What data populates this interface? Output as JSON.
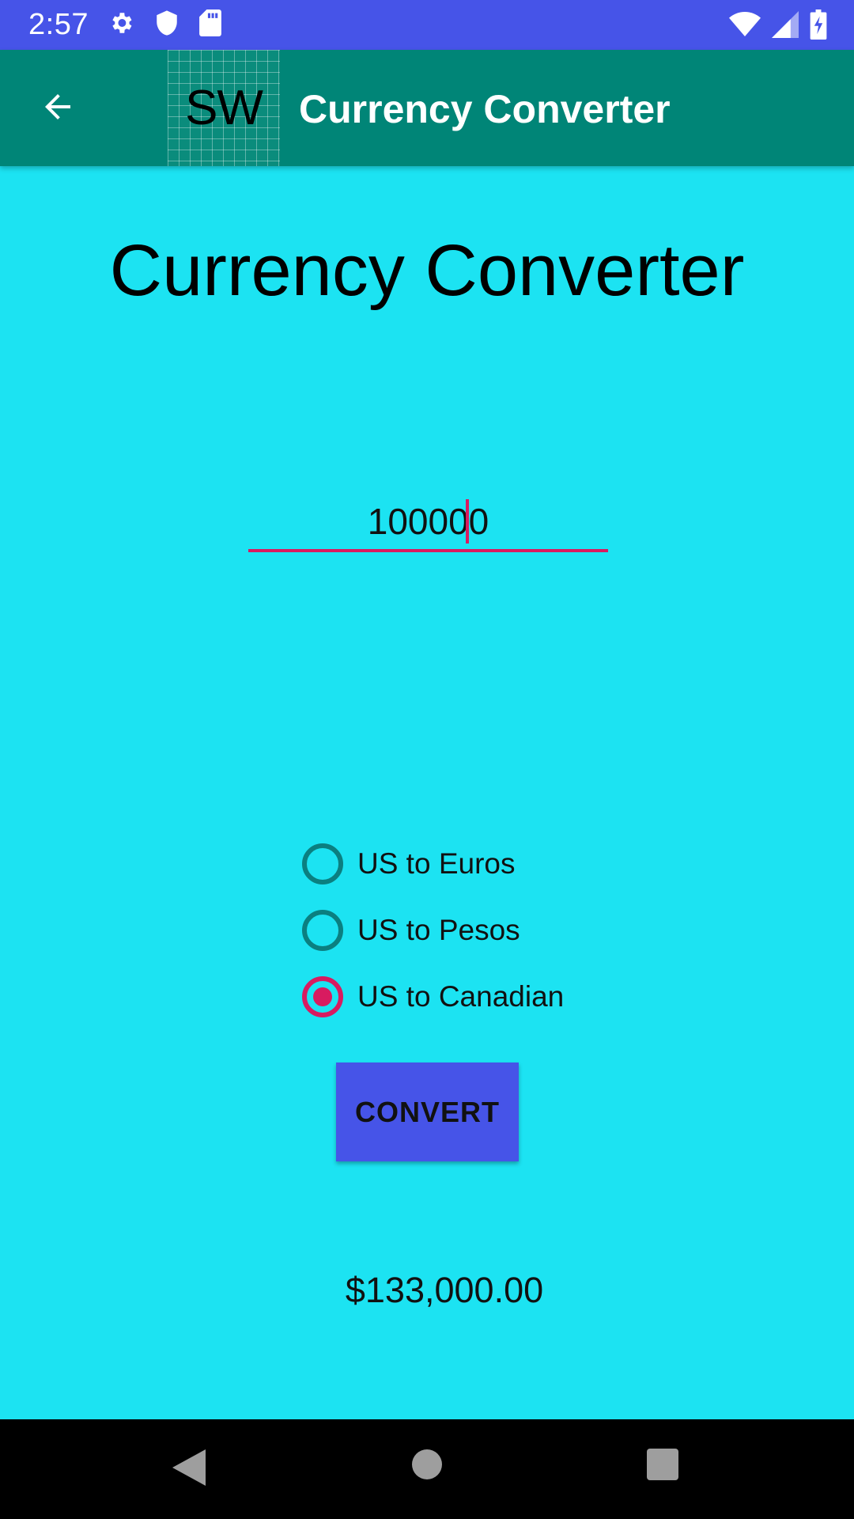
{
  "status_bar": {
    "time": "2:57",
    "left_icons": [
      "gear-icon",
      "shield-icon",
      "sd-card-icon"
    ],
    "right_icons": [
      "wifi-icon",
      "signal-icon",
      "battery-charging-icon"
    ]
  },
  "app_bar": {
    "back_icon": "arrow-back-icon",
    "logo_text": "SW",
    "title": "Currency Converter"
  },
  "main": {
    "heading": "Currency Converter",
    "amount_value": "100000",
    "conversion_options": [
      {
        "label": "US to Euros",
        "checked": false
      },
      {
        "label": "US to Pesos",
        "checked": false
      },
      {
        "label": "US to Canadian",
        "checked": true
      }
    ],
    "convert_label": "CONVERT",
    "result": "$133,000.00"
  },
  "colors": {
    "status_bar": "#4654e8",
    "app_bar": "#008577",
    "background": "#1ce3f2",
    "accent": "#d81b60",
    "radio_unchecked": "#0b7f80",
    "button": "#4654e8"
  },
  "nav_bar": {
    "icons": [
      "nav-back-icon",
      "nav-home-icon",
      "nav-recents-icon"
    ]
  }
}
